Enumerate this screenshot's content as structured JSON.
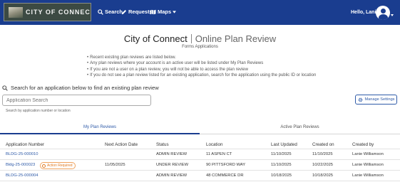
{
  "nav": {
    "logo_text": "CITY OF CONNECT",
    "search_label": "Search",
    "requests_label": "Requests",
    "maps_label": "Maps",
    "greeting": "Hello, Lanie",
    "bg_color": "#1a3d8f"
  },
  "header": {
    "city": "City of Connect",
    "app": "Online Plan Review",
    "subtitle": "Forms Applications"
  },
  "notes": [
    "Recent existing plan reviews are listed below.",
    "Any plan reviews where your account is an active user will be listed under My Plan Reviews",
    "If you are not a user on a plan review, you will not be able to access the plan review",
    "If you do not see a plan review listed for an existing application, search for the application using the public ID or location"
  ],
  "search": {
    "prompt": "Search for an application below to find an existing plan review",
    "placeholder": "Application Search",
    "hint": "Search by application number or location"
  },
  "manage_settings": "Manage Settings",
  "tabs": [
    {
      "label": "My Plan Reviews",
      "active": true
    },
    {
      "label": "Active Plan Reviews",
      "active": false
    }
  ],
  "table": {
    "columns": [
      "Application Number",
      "Next Action Date",
      "Status",
      "Location",
      "Last Updated",
      "Created on",
      "Created by"
    ],
    "rows": [
      {
        "app": "BLDG-25-000010",
        "badge": "",
        "next": "",
        "status": "ADMIN REVIEW",
        "location": "11 ASPEN CT",
        "updated": "11/10/2025",
        "created": "11/10/2025",
        "by": "Lanie Williamson"
      },
      {
        "app": "Bldg-25-000023",
        "badge": "Action Required",
        "next": "11/05/2025",
        "status": "UNDER REVIEW",
        "location": "90 PITTSFORD WAY",
        "updated": "11/10/2025",
        "created": "10/22/2025",
        "by": "Lanie Williamson"
      },
      {
        "app": "BLDG-25-000004",
        "badge": "",
        "next": "",
        "status": "ADMIN REVIEW",
        "location": "48 COMMERCE DR",
        "updated": "10/18/2025",
        "created": "10/18/2025",
        "by": "Lanie Williamson"
      }
    ]
  },
  "icons": {
    "search": "search-icon",
    "requests": "pencil-icon",
    "maps": "map-icon",
    "settings": "gear-icon",
    "badge": "clock-icon"
  }
}
